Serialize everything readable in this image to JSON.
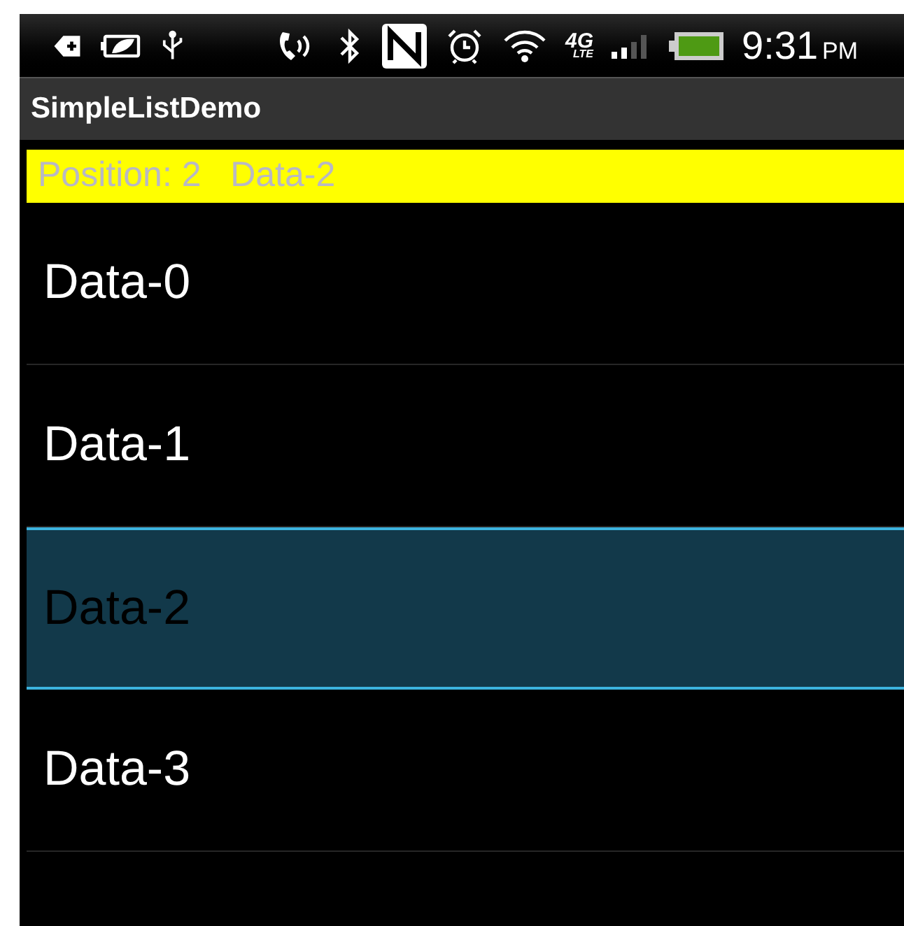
{
  "status_bar": {
    "network": [
      "4G",
      "LTE"
    ],
    "time": "9:31",
    "ampm": "PM"
  },
  "title_bar": {
    "title": "SimpleListDemo"
  },
  "selection_banner": {
    "text": "Position: 2   Data-2"
  },
  "list": [
    {
      "label": "Data-0",
      "selected": false
    },
    {
      "label": "Data-1",
      "selected": false
    },
    {
      "label": "Data-2",
      "selected": true
    },
    {
      "label": "Data-3",
      "selected": false
    }
  ]
}
